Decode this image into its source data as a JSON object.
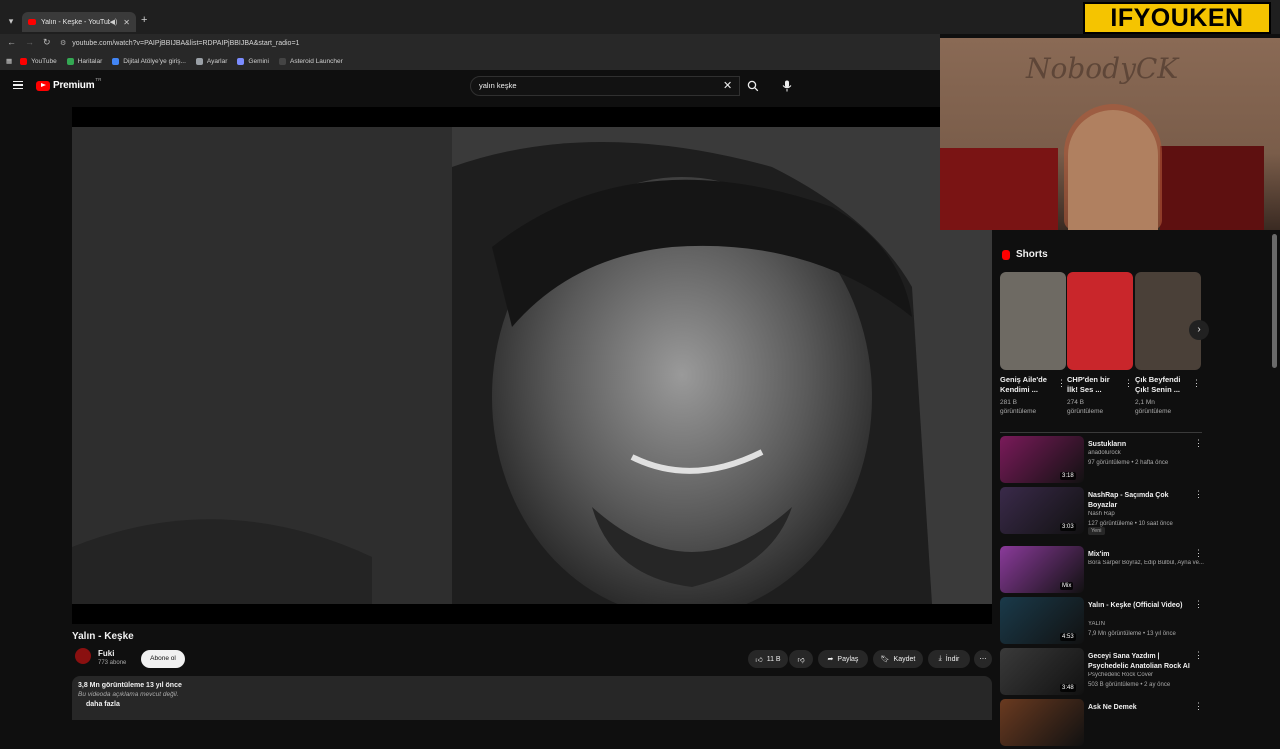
{
  "browser": {
    "tab_title": "Yalın - Keşke - YouTube",
    "url": "youtube.com/watch?v=PAIPjBBIJBA&list=RDPAIPjBBIJBA&start_radio=1",
    "bookmarks": [
      {
        "label": "YouTube",
        "color": "#ff0000"
      },
      {
        "label": "Haritalar",
        "color": "#34a853"
      },
      {
        "label": "Dijital Atölye'ye giriş...",
        "color": "#4285f4"
      },
      {
        "label": "Ayarlar",
        "color": "#9aa0a6"
      },
      {
        "label": "Gemini",
        "color": "#7b8cff"
      },
      {
        "label": "Asteroid Launcher",
        "color": "#444444"
      }
    ]
  },
  "header": {
    "logo_text": "Premium",
    "country": "TR",
    "search_value": "yalın keşke"
  },
  "video": {
    "title": "Yalın - Keşke",
    "channel": "Fuki",
    "subscribers": "773 abone",
    "subscribe_label": "Abone ol",
    "likes": "11 B",
    "share_label": "Paylaş",
    "save_label": "Kaydet",
    "download_label": "İndir",
    "desc_meta": "3,8 Mn görüntüleme  13 yıl önce",
    "desc_text": "Bu videoda açıklama mevcut değil.",
    "desc_more": "daha fazla"
  },
  "overlay": {
    "cam_text": "NobodyCK",
    "brand": "IFYOUKEN"
  },
  "shorts": {
    "heading": "Shorts",
    "items": [
      {
        "title": "Geniş Aile'de Kendimi ...",
        "views": "281 B görüntüleme",
        "color": "#6e6a63"
      },
      {
        "title": "CHP'den bir İlk! Ses ...",
        "views": "274 B görüntüleme",
        "color": "#c9262b"
      },
      {
        "title": "Çık Beyfendi Çık! Senin ...",
        "views": "2,1 Mn görüntüleme",
        "color": "#4a4038"
      }
    ]
  },
  "recommendations": [
    {
      "title": "Sustukların",
      "channel": "anadolurock",
      "meta": "97 görüntüleme • 2 hafta önce",
      "duration": "3:18",
      "color": "#7a1a5a",
      "badge": ""
    },
    {
      "title": "NashRap - Saçımda Çok Boyazlar",
      "channel": "Nash Rap",
      "meta": "127 görüntüleme • 10 saat önce",
      "duration": "3:03",
      "color": "#3a2a4a",
      "badge": "Yeni"
    },
    {
      "title": "Mix'im",
      "channel": "Bora Sarper Boyraz, Edip Bülbül, Ayna ve...",
      "meta": "",
      "duration": "Mix",
      "color": "#8a3a9a",
      "badge": ""
    },
    {
      "title": "Yalın - Keşke (Official Video)",
      "channel": "YALIN",
      "meta": "7,9 Mn görüntüleme • 13 yıl önce",
      "duration": "4:53",
      "color": "#1a3a4a",
      "badge": ""
    },
    {
      "title": "Geceyi Sana Yazdım | Psychedelic Anatolian Rock AI",
      "channel": "Psychedelic Rock Cover",
      "meta": "503 B görüntüleme • 2 ay önce",
      "duration": "3:48",
      "color": "#3a3a3a",
      "badge": ""
    },
    {
      "title": "Ask Ne Demek",
      "channel": "",
      "meta": "",
      "duration": "",
      "color": "#6a3a20",
      "badge": ""
    }
  ]
}
